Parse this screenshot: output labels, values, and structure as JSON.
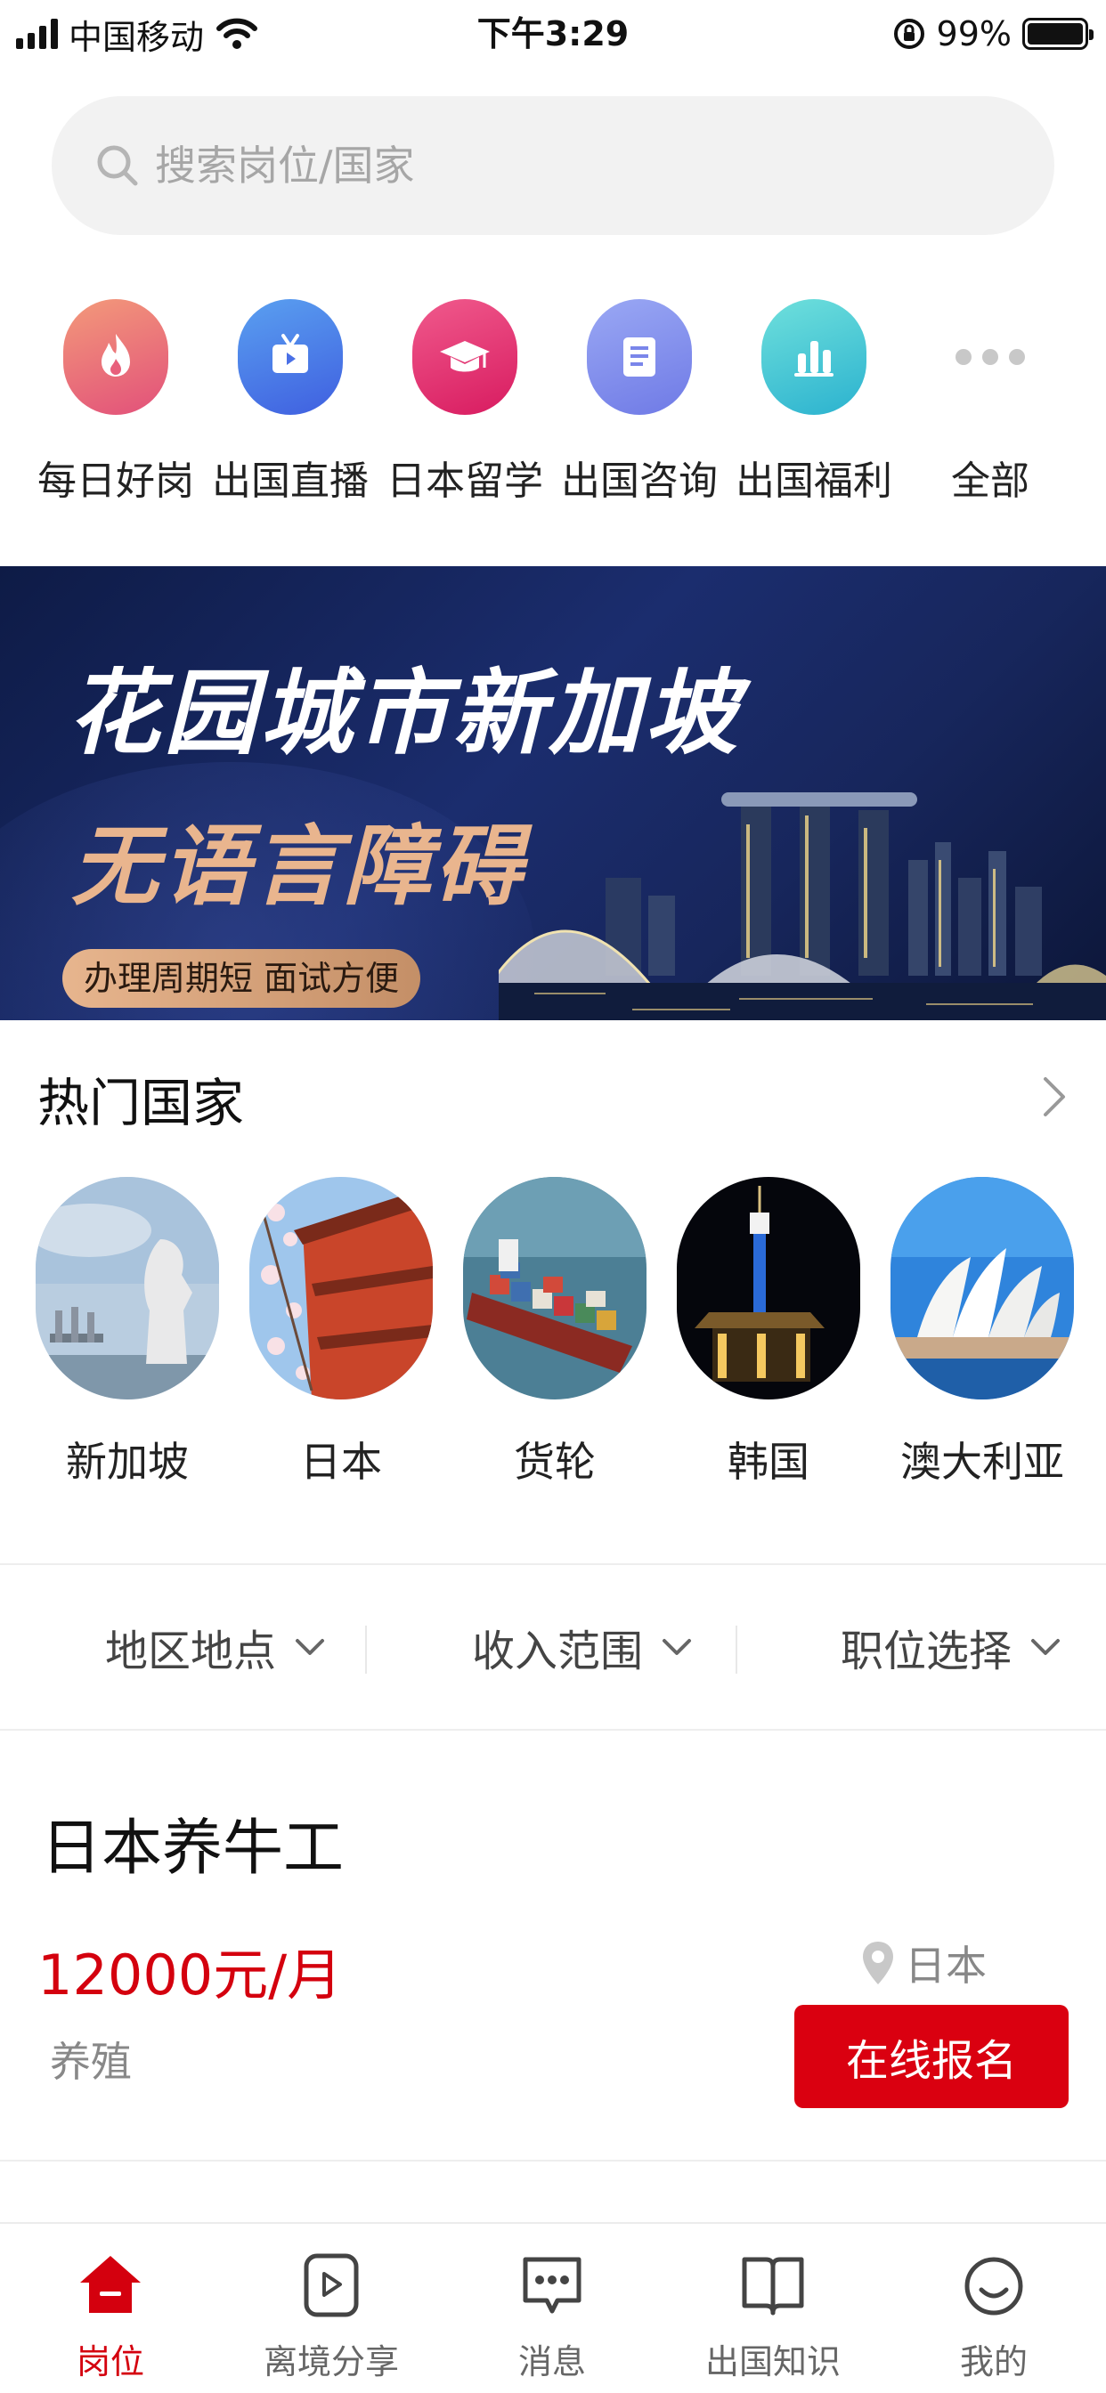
{
  "status_bar": {
    "carrier": "中国移动",
    "time": "下午3:29",
    "battery": "99%"
  },
  "search": {
    "placeholder": "搜索岗位/国家"
  },
  "categories": [
    {
      "label": "每日好岗",
      "icon": "flame-icon",
      "color": "#e2507a"
    },
    {
      "label": "出国直播",
      "icon": "tv-icon",
      "color": "#4a7be8"
    },
    {
      "label": "日本留学",
      "icon": "graduation-cap-icon",
      "color": "#e4226a"
    },
    {
      "label": "出国咨询",
      "icon": "document-icon",
      "color": "#7a86ea"
    },
    {
      "label": "出国福利",
      "icon": "bar-chart-icon",
      "color": "#39c2d4"
    },
    {
      "label": "全部",
      "icon": "more-dots-icon",
      "color": "#c8c8c8"
    }
  ],
  "banner": {
    "title_line1": "花园城市新加坡",
    "title_line2": "无语言障碍",
    "tag": "办理周期短 面试方便"
  },
  "hot_countries": {
    "title": "热门国家",
    "items": [
      {
        "label": "新加坡"
      },
      {
        "label": "日本"
      },
      {
        "label": "货轮"
      },
      {
        "label": "韩国"
      },
      {
        "label": "澳大利亚"
      }
    ]
  },
  "filters": [
    {
      "label": "地区地点"
    },
    {
      "label": "收入范围"
    },
    {
      "label": "职位选择"
    }
  ],
  "job": {
    "title": "日本养牛工",
    "salary": "12000元/月",
    "location": "日本",
    "category": "养殖",
    "apply_label": "在线报名"
  },
  "tabs": [
    {
      "label": "岗位",
      "active": true
    },
    {
      "label": "离境分享",
      "active": false
    },
    {
      "label": "消息",
      "active": false
    },
    {
      "label": "出国知识",
      "active": false
    },
    {
      "label": "我的",
      "active": false
    }
  ],
  "colors": {
    "accent": "#d4000e",
    "banner_gold": "#e9b58e"
  }
}
